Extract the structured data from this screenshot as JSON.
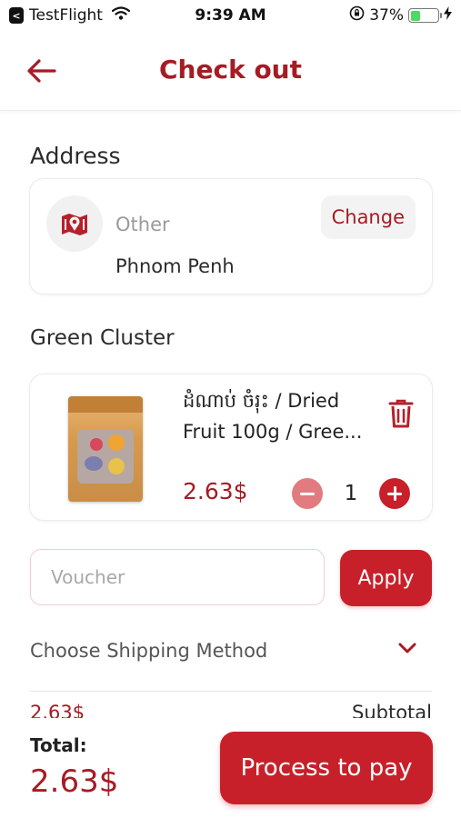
{
  "status_bar": {
    "app_name": "TestFlight",
    "time": "9:39 AM",
    "battery_percent": "37%",
    "battery_level": 0.37
  },
  "header": {
    "title": "Check out"
  },
  "address": {
    "section_label": "Address",
    "type": "Other",
    "city": "Phnom Penh",
    "change_label": "Change"
  },
  "store": {
    "name": "Green Cluster"
  },
  "cart": {
    "items": [
      {
        "name_line1": "ដំណាប់ ចំរុះ / Dried",
        "name_line2": "Fruit 100g / Gree...",
        "price": "2.63$",
        "quantity": "1"
      }
    ]
  },
  "voucher": {
    "placeholder": "Voucher",
    "apply_label": "Apply"
  },
  "shipping": {
    "label": "Choose Shipping Method"
  },
  "summary": {
    "subtotal_amount": "2.63$",
    "subtotal_label": "Subtotal"
  },
  "footer": {
    "total_label": "Total:",
    "total_value": "2.63$",
    "pay_label": "Process to pay"
  },
  "colors": {
    "brand": "#a51c24",
    "button": "#c8202a",
    "minus_button": "#e27b7f"
  }
}
